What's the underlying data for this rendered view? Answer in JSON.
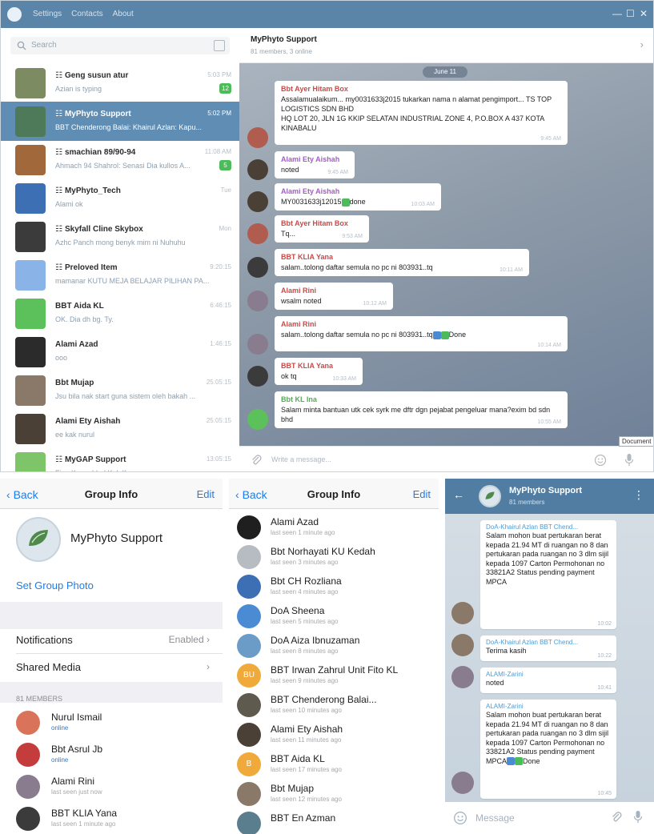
{
  "desktop": {
    "menu": [
      "Settings",
      "Contacts",
      "About"
    ],
    "window_controls": [
      "—",
      "☐",
      "✕"
    ],
    "search_placeholder": "Search",
    "dialogs": [
      {
        "name": "Geng susun atur",
        "preview": "Azian is typing",
        "time": "5:03 PM",
        "badge": "12",
        "group": true,
        "selected": false,
        "color": "#7d8b63"
      },
      {
        "name": "MyPhyto Support",
        "preview": "BBT Chenderong Balai: Khairul Azlan: Kapu...",
        "time": "5:02 PM",
        "badge": "",
        "group": true,
        "selected": true,
        "color": "#4f7a5a"
      },
      {
        "name": "smachian 89/90-94",
        "preview": "Ahmach 94 Shahrol: Senasi Dia kullos A...",
        "time": "11:08 AM",
        "badge": "5",
        "group": true,
        "selected": false,
        "color": "#a0683b"
      },
      {
        "name": "MyPhyto_Tech",
        "preview": "Alami ok",
        "time": "Tue",
        "badge": "",
        "group": true,
        "selected": false,
        "color": "#3d6fb4"
      },
      {
        "name": "Skyfall Cline Skybox",
        "preview": "Azhc Panch mong benyk mim ni Nuhuhu",
        "time": "Mon",
        "badge": "",
        "group": true,
        "selected": false,
        "color": "#3b3b3b"
      },
      {
        "name": "Preloved Item",
        "preview": "mamanar KUTU MEJA BELAJAR PILIHAN PA...",
        "time": "9:20:15",
        "badge": "",
        "group": true,
        "selected": false,
        "color": "#8ab4e8"
      },
      {
        "name": "BBT Aida KL",
        "preview": "OK. Dia dh bg. Ty.",
        "time": "6:46:15",
        "badge": "",
        "group": false,
        "selected": false,
        "color": "#5cc15a"
      },
      {
        "name": "Alami Azad",
        "preview": "ooo",
        "time": "1:46:15",
        "badge": "",
        "group": false,
        "selected": false,
        "color": "#2b2b2b"
      },
      {
        "name": "Bbt Mujap",
        "preview": "Jsu bila nak start guna sistem oleh bakah ...",
        "time": "25:05:15",
        "badge": "",
        "group": false,
        "selected": false,
        "color": "#8a7868"
      },
      {
        "name": "Alami Ety Aishah",
        "preview": "ee kak nurul",
        "time": "25:05:15",
        "badge": "",
        "group": false,
        "selected": false,
        "color": "#4a4036"
      },
      {
        "name": "MyGAP Support",
        "preview": "Fina Kus added Kak Ifna",
        "time": "13:05:15",
        "badge": "",
        "group": true,
        "selected": false,
        "color": "#7ec468"
      }
    ],
    "chat_title": "MyPhyto Support",
    "chat_subtitle": "81 members, 3 online",
    "date_pill": "June 11",
    "messages": [
      {
        "from": "Bbt Ayer Hitam Box",
        "from_color": "#c94a4a",
        "body": "Assalamualaikum... my0031633j2015 tukarkan nama n alamat pengimport... TS TOP LOGISTICS SDN BHD\nHQ LOT 20, JLN 1G KKIP SELATAN INDUSTRIAL ZONE 4, P.O.BOX A 437 KOTA KINABALU",
        "time": "9:45 AM",
        "check": ""
      },
      {
        "from": "Alami Ety Aishah",
        "from_color": "#a45cc7",
        "body": "noted",
        "time": "9:45 AM",
        "check": ""
      },
      {
        "from": "Alami Ety Aishah",
        "from_color": "#a45cc7",
        "body": "MY0031633j12015",
        "time": "10:03 AM",
        "check": "done"
      },
      {
        "from": "Bbt Ayer Hitam Box",
        "from_color": "#c94a4a",
        "body": "Tq...",
        "time": "9:53 AM",
        "check": ""
      },
      {
        "from": "BBT KLIA Yana",
        "from_color": "#c94a4a",
        "body": "salam..tolong daftar semula no pc ni 803931..tq",
        "time": "10:11 AM",
        "check": ""
      },
      {
        "from": "Alami Rini",
        "from_color": "#c94a4a",
        "body": "wsalm noted",
        "time": "10:12 AM",
        "check": ""
      },
      {
        "from": "Alami Rini",
        "from_color": "#c94a4a",
        "body": "salam..tolong daftar semula no pc ni 803931..tq",
        "time": "10:14 AM",
        "check": "Done"
      },
      {
        "from": "BBT KLIA Yana",
        "from_color": "#c94a4a",
        "body": "ok tq",
        "time": "10:33 AM",
        "check": ""
      },
      {
        "from": "Bbt KL Ina",
        "from_color": "#5aa95a",
        "body": "Salam minta bantuan utk cek syrk me dftr dgn pejabat pengeluar mana?exim bd sdn bhd",
        "time": "10:55 AM",
        "check": ""
      }
    ],
    "input_placeholder": "Write a message...",
    "tooltip": "Document"
  },
  "panel1": {
    "back": "Back",
    "title": "Group Info",
    "edit": "Edit",
    "group_name": "MyPhyto Support",
    "set_photo": "Set Group Photo",
    "notifications_label": "Notifications",
    "notifications_value": "Enabled",
    "shared_media_label": "Shared Media",
    "members_header": "81 MEMBERS",
    "members": [
      {
        "name": "Nurul Ismail",
        "status": "online",
        "online": true,
        "color": "#d9735a"
      },
      {
        "name": "Bbt Asrul Jb",
        "status": "online",
        "online": true,
        "color": "#c43c3c"
      },
      {
        "name": "Alami Rini",
        "status": "last seen just now",
        "online": false,
        "color": "#8a7c8f"
      },
      {
        "name": "BBT KLIA Yana",
        "status": "last seen 1 minute ago",
        "online": false,
        "color": "#3b3b3b"
      }
    ]
  },
  "panel2": {
    "back": "Back",
    "title": "Group Info",
    "edit": "Edit",
    "members": [
      {
        "name": "Alami Azad",
        "status": "last seen 1 minute ago",
        "color": "#1f1f1f"
      },
      {
        "name": "Bbt Norhayati KU Kedah",
        "status": "last seen 3 minutes ago",
        "color": "#b7bcc2"
      },
      {
        "name": "Bbt CH Rozliana",
        "status": "last seen 4 minutes ago",
        "color": "#3d6fb4"
      },
      {
        "name": "DoA Sheena",
        "status": "last seen 5 minutes ago",
        "color": "#4a8bd4"
      },
      {
        "name": "DoA Aiza Ibnuzaman",
        "status": "last seen 8 minutes ago",
        "color": "#6b9bc7"
      },
      {
        "name": "BBT Irwan Zahrul Unit Fito KL",
        "status": "last seen 9 minutes ago",
        "color": "#f0a93b",
        "initials": "BU"
      },
      {
        "name": "BBT Chenderong Balai...",
        "status": "last seen 10 minutes ago",
        "color": "#5e5a4e"
      },
      {
        "name": "Alami Ety Aishah",
        "status": "last seen 11 minutes ago",
        "color": "#4a4036"
      },
      {
        "name": "BBT Aida KL",
        "status": "last seen 17 minutes ago",
        "color": "#f0a93b",
        "initials": "B"
      },
      {
        "name": "Bbt Mujap",
        "status": "last seen 12 minutes ago",
        "color": "#8a7868"
      },
      {
        "name": "BBT En Azman",
        "status": "",
        "color": "#5a7e8e"
      }
    ]
  },
  "panel3": {
    "title": "MyPhyto Support",
    "subtitle": "81 members",
    "messages": [
      {
        "from": "DoA-Khairul Azlan BBT Chend...",
        "body": "Salam mohon buat pertukaran berat kepada 21.94 MT di ruangan no 8 dan pertukaran pada ruangan no 3 dlm sijil kepada 1097 Carton Permohonan no 33821A2 Status pending payment MPCA",
        "time": "10:02",
        "check": ""
      },
      {
        "from": "DoA-Khairul Azlan BBT Chend...",
        "body": "Terima kasih",
        "time": "10:22",
        "check": ""
      },
      {
        "from": "ALAMI-Zarini",
        "body": "noted",
        "time": "10:41",
        "check": ""
      },
      {
        "from": "ALAMI-Zarini",
        "body": "Salam mohon buat pertukaran berat kepada 21.94 MT di ruangan no 8 dan pertukaran pada ruangan no 3 dlm sijil kepada 1097 Carton Permohonan no 33821A2 Status pending payment MPCA",
        "time": "10:45",
        "check": "Done"
      }
    ],
    "input_placeholder": "Message"
  },
  "icons": {
    "search": "search-icon",
    "attach": "paperclip-icon",
    "emoji": "emoji-icon",
    "mic": "microphone-icon"
  }
}
